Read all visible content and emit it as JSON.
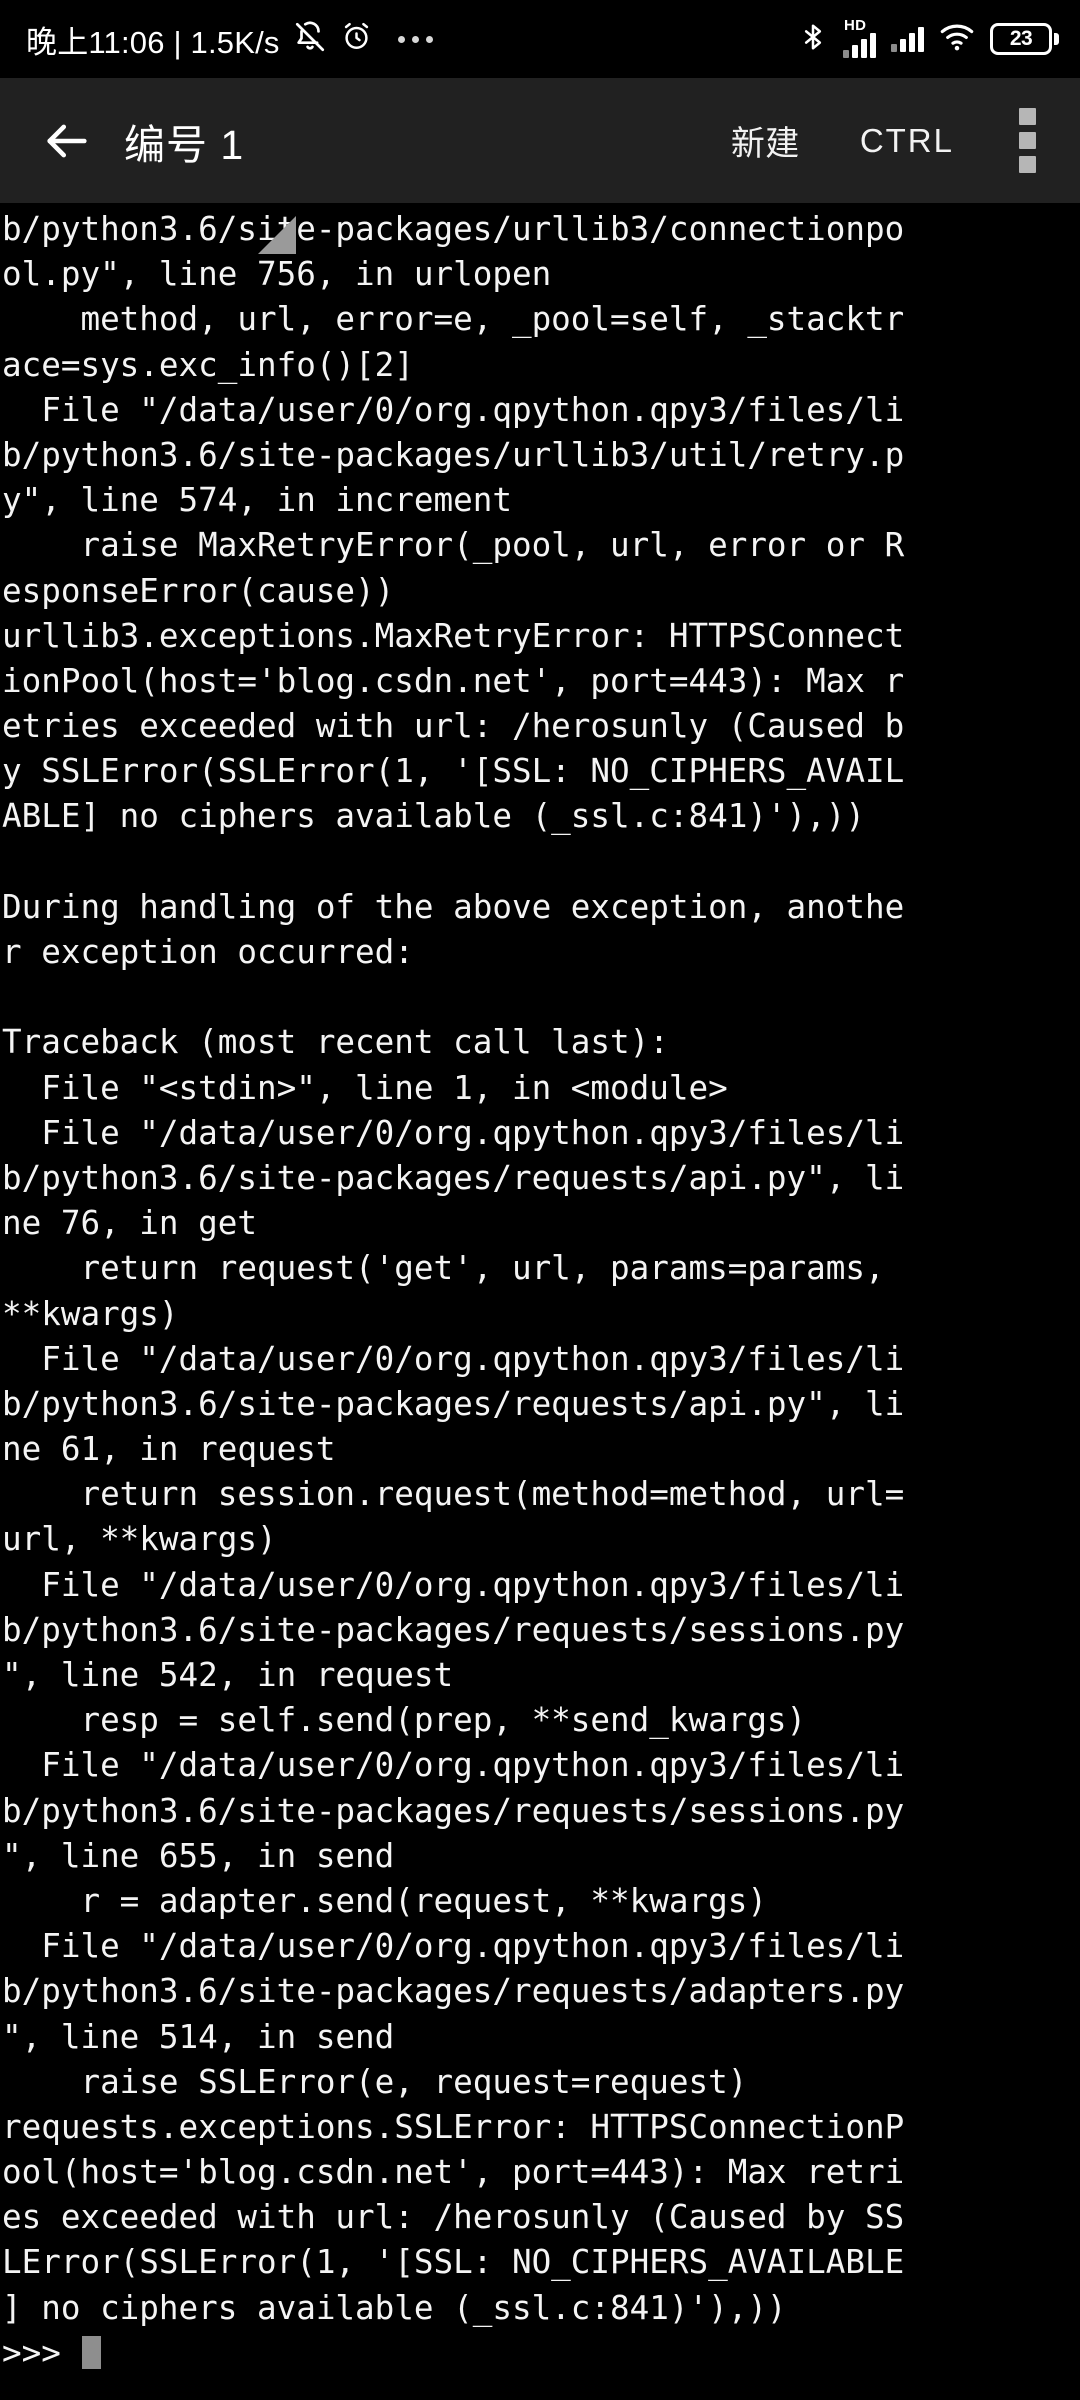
{
  "statusbar": {
    "clock": "晚上11:06 | 1.5K/s",
    "icons_left": [
      "bell-muted-icon",
      "alarm-clock-icon",
      "more-dots-icon"
    ],
    "icons_right": [
      "bluetooth-icon",
      "signal-hd-icon",
      "signal-icon",
      "wifi-icon",
      "battery-icon"
    ],
    "network_label": "HD",
    "battery_level": "23"
  },
  "toolbar": {
    "back_icon": "back-arrow-icon",
    "title": "编号 1",
    "new_label": "新建",
    "ctrl_label": "CTRL",
    "overflow_icon": "overflow-menu-icon",
    "resize_handle_icon": "resize-handle-triangle-icon",
    "background_color": "#212121"
  },
  "terminal": {
    "background_color": "#000000",
    "text_color": "#f4f4f4",
    "cursor_color": "#8e8e8e",
    "prompt": ">>> ",
    "lines": [
      "b/python3.6/site-packages/urllib3/connectionpo",
      "ol.py\", line 756, in urlopen",
      "    method, url, error=e, _pool=self, _stacktr",
      "ace=sys.exc_info()[2]",
      "  File \"/data/user/0/org.qpython.qpy3/files/li",
      "b/python3.6/site-packages/urllib3/util/retry.p",
      "y\", line 574, in increment",
      "    raise MaxRetryError(_pool, url, error or R",
      "esponseError(cause))",
      "urllib3.exceptions.MaxRetryError: HTTPSConnect",
      "ionPool(host='blog.csdn.net', port=443): Max r",
      "etries exceeded with url: /herosunly (Caused b",
      "y SSLError(SSLError(1, '[SSL: NO_CIPHERS_AVAIL",
      "ABLE] no ciphers available (_ssl.c:841)'),))",
      "",
      "During handling of the above exception, anothe",
      "r exception occurred:",
      "",
      "Traceback (most recent call last):",
      "  File \"<stdin>\", line 1, in <module>",
      "  File \"/data/user/0/org.qpython.qpy3/files/li",
      "b/python3.6/site-packages/requests/api.py\", li",
      "ne 76, in get",
      "    return request('get', url, params=params,",
      "**kwargs)",
      "  File \"/data/user/0/org.qpython.qpy3/files/li",
      "b/python3.6/site-packages/requests/api.py\", li",
      "ne 61, in request",
      "    return session.request(method=method, url=",
      "url, **kwargs)",
      "  File \"/data/user/0/org.qpython.qpy3/files/li",
      "b/python3.6/site-packages/requests/sessions.py",
      "\", line 542, in request",
      "    resp = self.send(prep, **send_kwargs)",
      "  File \"/data/user/0/org.qpython.qpy3/files/li",
      "b/python3.6/site-packages/requests/sessions.py",
      "\", line 655, in send",
      "    r = adapter.send(request, **kwargs)",
      "  File \"/data/user/0/org.qpython.qpy3/files/li",
      "b/python3.6/site-packages/requests/adapters.py",
      "\", line 514, in send",
      "    raise SSLError(e, request=request)",
      "requests.exceptions.SSLError: HTTPSConnectionP",
      "ool(host='blog.csdn.net', port=443): Max retri",
      "es exceeded with url: /herosunly (Caused by SS",
      "LError(SSLError(1, '[SSL: NO_CIPHERS_AVAILABLE",
      "] no ciphers available (_ssl.c:841)'),))"
    ]
  }
}
